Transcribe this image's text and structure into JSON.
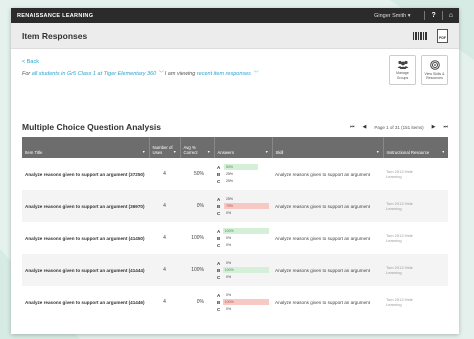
{
  "topbar": {
    "logo": "RENAISSANCE LEARNING",
    "user": "Ginger Smith",
    "user_caret": "▾",
    "help": "?",
    "home": "⌂"
  },
  "header": {
    "title": "Item Responses",
    "pdf_label": "PDF"
  },
  "filters": {
    "back": "< Back",
    "for_prefix": "For ",
    "for_link": "all students in Gr5 Class 1 at Tiger Elementary 360 ",
    "viewing_prefix": " I am viewing ",
    "viewing_link": "recent item responses ",
    "chevron": "﹀"
  },
  "actions": [
    {
      "label": "Manage Groups",
      "icon": "group-icon"
    },
    {
      "label": "View Skills & Resources",
      "icon": "target-icon"
    }
  ],
  "section": {
    "title": "Multiple Choice Question Analysis"
  },
  "pager": {
    "first": "⏮",
    "prev": "◀",
    "text": "Page 1 of 31 (151 items)",
    "next": "▶",
    "last": "⏭"
  },
  "table": {
    "headers": [
      "Item Title",
      "Number of Uses",
      "Avg % Correct",
      "Answers",
      "Skill",
      "Instructional Resource"
    ],
    "rows": [
      {
        "title": "Analyze reasons given to support an argument (37250)",
        "uses": "4",
        "avg": "50%",
        "answers": [
          {
            "letter": "A",
            "pct": "50%",
            "frac": 0.5,
            "color": "green"
          },
          {
            "letter": "B",
            "pct": "25%",
            "frac": 0.25,
            "color": "none"
          },
          {
            "letter": "C",
            "pct": "25%",
            "frac": 0.25,
            "color": "none"
          }
        ],
        "skill": "Analyze reasons given to support an argument",
        "resource": "Tom 2013 Hide",
        "resource2": "Learning"
      },
      {
        "title": "Analyze reasons given to support an argument (36970)",
        "uses": "4",
        "avg": "0%",
        "answers": [
          {
            "letter": "A",
            "pct": "25%",
            "frac": 0.25,
            "color": "none"
          },
          {
            "letter": "B",
            "pct": "75%",
            "frac": 0.75,
            "color": "red"
          },
          {
            "letter": "C",
            "pct": "0%",
            "frac": 0,
            "color": "none"
          }
        ],
        "skill": "Analyze reasons given to support an argument",
        "resource": "Tom 2013 Hide",
        "resource2": "Learning"
      },
      {
        "title": "Analyze reasons given to support an argument (41450)",
        "uses": "4",
        "avg": "100%",
        "answers": [
          {
            "letter": "A",
            "pct": "100%",
            "frac": 1,
            "color": "green"
          },
          {
            "letter": "B",
            "pct": "0%",
            "frac": 0,
            "color": "none"
          },
          {
            "letter": "C",
            "pct": "0%",
            "frac": 0,
            "color": "none"
          }
        ],
        "skill": "Analyze reasons given to support an argument",
        "resource": "Tom 2013 Hide",
        "resource2": "Learning"
      },
      {
        "title": "Analyze reasons given to support an argument (41444)",
        "uses": "4",
        "avg": "100%",
        "answers": [
          {
            "letter": "A",
            "pct": "0%",
            "frac": 0,
            "color": "none"
          },
          {
            "letter": "B",
            "pct": "100%",
            "frac": 1,
            "color": "green"
          },
          {
            "letter": "C",
            "pct": "0%",
            "frac": 0,
            "color": "none"
          }
        ],
        "skill": "Analyze reasons given to support an argument",
        "resource": "Tom 2013 Hide",
        "resource2": "Learning"
      },
      {
        "title": "Analyze reasons given to support an argument (41446)",
        "uses": "4",
        "avg": "0%",
        "answers": [
          {
            "letter": "A",
            "pct": "0%",
            "frac": 0,
            "color": "none"
          },
          {
            "letter": "B",
            "pct": "100%",
            "frac": 1,
            "color": "red"
          },
          {
            "letter": "C",
            "pct": "0%",
            "frac": 0,
            "color": "none"
          }
        ],
        "skill": "Analyze reasons given to support an argument",
        "resource": "Tom 2013 Hide",
        "resource2": "Learning"
      }
    ]
  }
}
